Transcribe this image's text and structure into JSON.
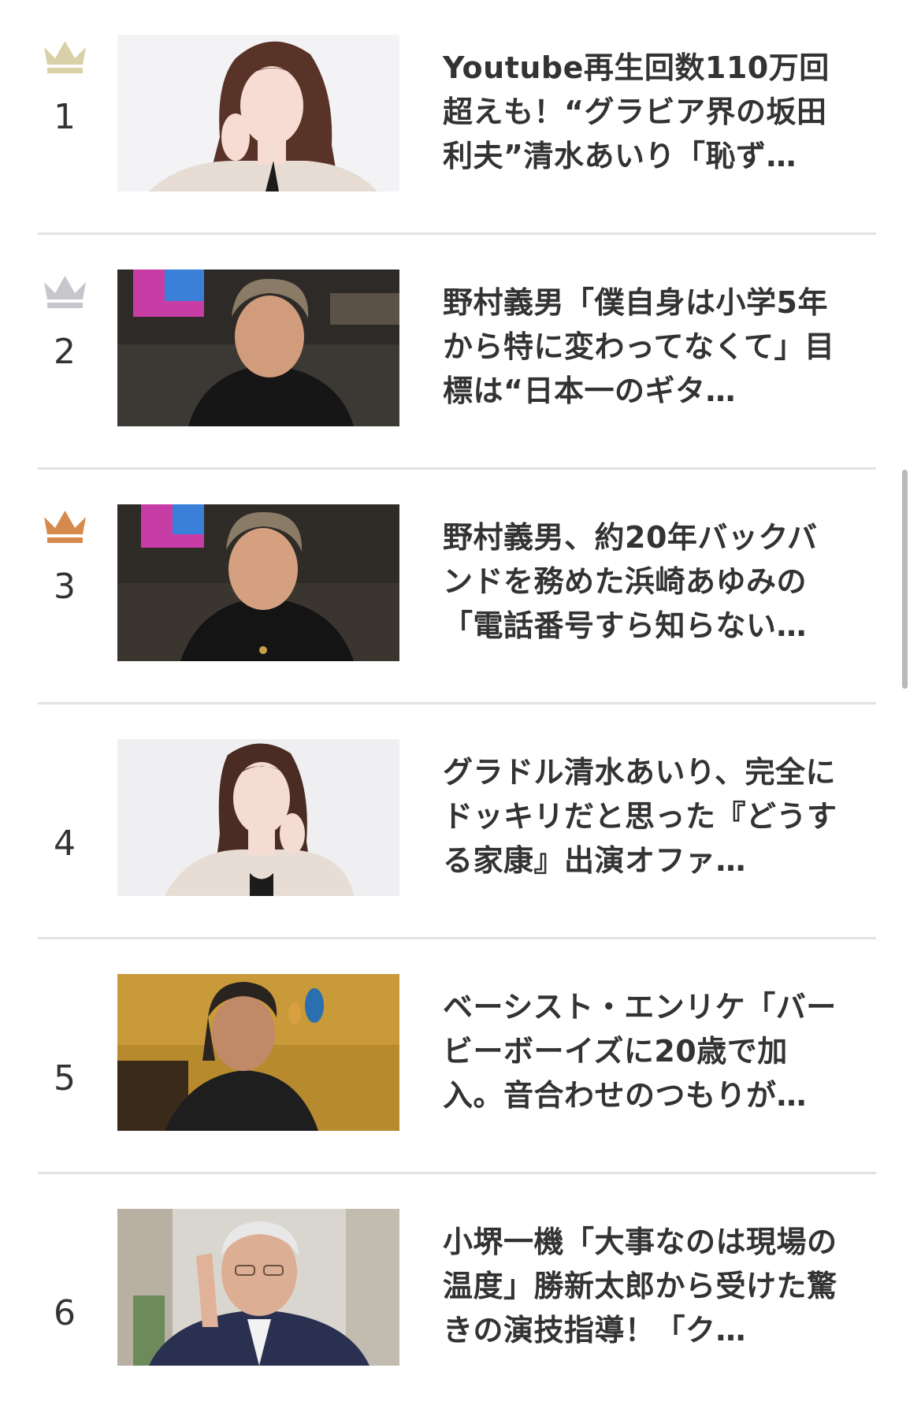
{
  "colors": {
    "gold": "#d9d0a7",
    "silver": "#c6c6cc",
    "bronze": "#d5894a",
    "divider": "#e2e2e2",
    "text": "#333333"
  },
  "ranking": [
    {
      "rank": "1",
      "crown": "gold-crown-icon",
      "lines": [
        "Youtube再生回数110万回",
        "超えも！“グラビア界の坂田",
        "利夫”清水あいり「恥ず…"
      ]
    },
    {
      "rank": "2",
      "crown": "silver-crown-icon",
      "lines": [
        "野村義男「僕自身は小学5年",
        "から特に変わってなくて」目",
        "標は“日本一のギタ…"
      ]
    },
    {
      "rank": "3",
      "crown": "bronze-crown-icon",
      "lines": [
        "野村義男、約20年バックバ",
        "ンドを務めた浜崎あゆみの",
        "「電話番号すら知らない…"
      ]
    },
    {
      "rank": "4",
      "crown": "",
      "lines": [
        "グラドル清水あいり、完全に",
        "ドッキリだと思った『どうす",
        "る家康』出演オファ…"
      ]
    },
    {
      "rank": "5",
      "crown": "",
      "lines": [
        "ベーシスト・エンリケ「バー",
        "ビーボーイズに20歳で加",
        "入。音合わせのつもりが…"
      ]
    },
    {
      "rank": "6",
      "crown": "",
      "lines": [
        "小堺一機「大事なのは現場の",
        "温度」勝新太郎から受けた驚",
        "きの演技指導！「ク…"
      ]
    }
  ]
}
